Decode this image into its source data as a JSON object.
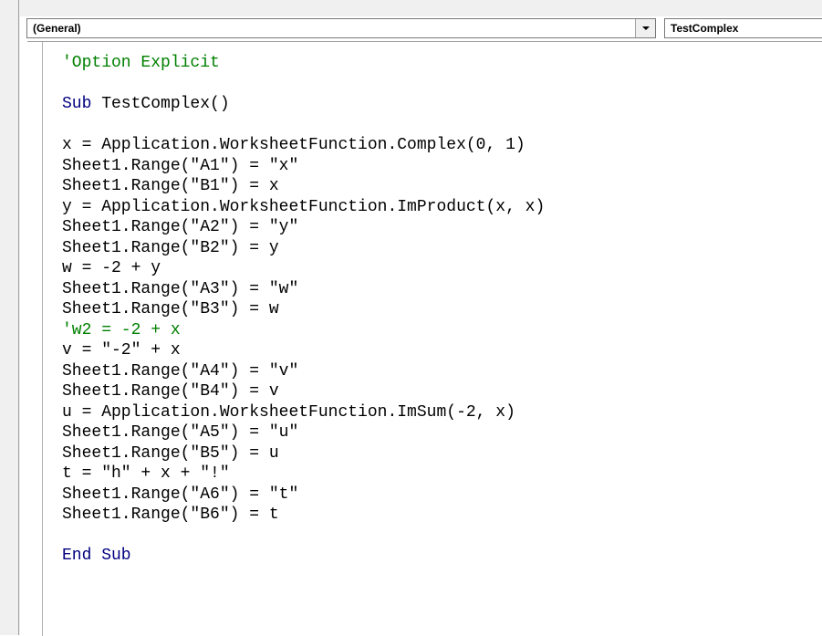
{
  "object_selector": {
    "value": "(General)"
  },
  "procedure_selector": {
    "value": "TestComplex"
  },
  "code_lines": [
    {
      "type": "comment",
      "text": "'Option Explicit"
    },
    {
      "type": "blank",
      "text": ""
    },
    {
      "type": "kw",
      "kw": "Sub",
      "rest": " TestComplex()"
    },
    {
      "type": "blank",
      "text": ""
    },
    {
      "type": "code",
      "text": "x = Application.WorksheetFunction.Complex(0, 1)"
    },
    {
      "type": "code",
      "text": "Sheet1.Range(\"A1\") = \"x\""
    },
    {
      "type": "code",
      "text": "Sheet1.Range(\"B1\") = x"
    },
    {
      "type": "code",
      "text": "y = Application.WorksheetFunction.ImProduct(x, x)"
    },
    {
      "type": "code",
      "text": "Sheet1.Range(\"A2\") = \"y\""
    },
    {
      "type": "code",
      "text": "Sheet1.Range(\"B2\") = y"
    },
    {
      "type": "code",
      "text": "w = -2 + y"
    },
    {
      "type": "code",
      "text": "Sheet1.Range(\"A3\") = \"w\""
    },
    {
      "type": "code",
      "text": "Sheet1.Range(\"B3\") = w"
    },
    {
      "type": "comment",
      "text": "'w2 = -2 + x"
    },
    {
      "type": "code",
      "text": "v = \"-2\" + x"
    },
    {
      "type": "code",
      "text": "Sheet1.Range(\"A4\") = \"v\""
    },
    {
      "type": "code",
      "text": "Sheet1.Range(\"B4\") = v"
    },
    {
      "type": "code",
      "text": "u = Application.WorksheetFunction.ImSum(-2, x)"
    },
    {
      "type": "code",
      "text": "Sheet1.Range(\"A5\") = \"u\""
    },
    {
      "type": "code",
      "text": "Sheet1.Range(\"B5\") = u"
    },
    {
      "type": "code",
      "text": "t = \"h\" + x + \"!\""
    },
    {
      "type": "code",
      "text": "Sheet1.Range(\"A6\") = \"t\""
    },
    {
      "type": "code",
      "text": "Sheet1.Range(\"B6\") = t"
    },
    {
      "type": "blank",
      "text": ""
    },
    {
      "type": "kw",
      "kw": "End Sub",
      "rest": ""
    }
  ],
  "colors": {
    "keyword": "#00007f",
    "comment": "#008000",
    "text": "#000000"
  }
}
